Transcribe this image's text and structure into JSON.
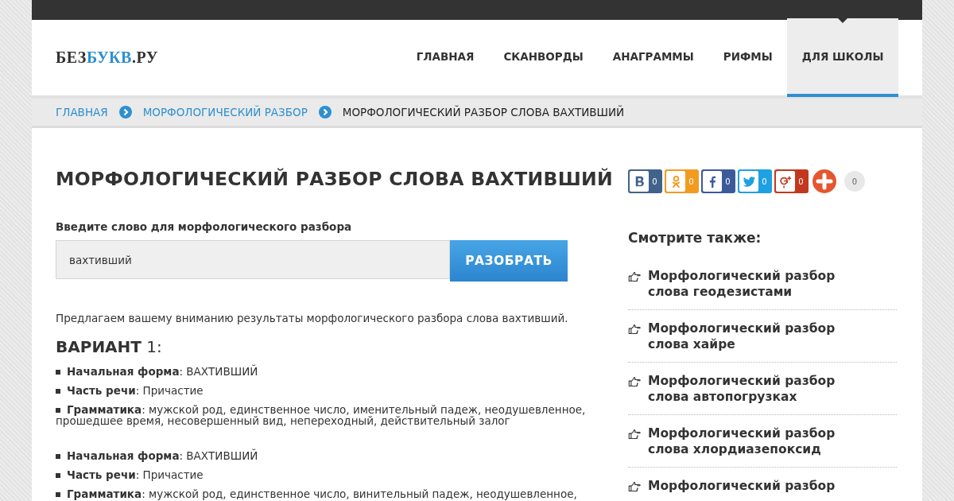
{
  "logo": {
    "parts": [
      {
        "text": "БЕЗ",
        "accent": false
      },
      {
        "text": "БУКВ",
        "accent": true
      },
      {
        "text": ".РУ",
        "accent": false
      }
    ]
  },
  "nav": [
    {
      "label": "ГЛАВНАЯ",
      "selected": false
    },
    {
      "label": "СКАНВОРДЫ",
      "selected": false
    },
    {
      "label": "АНАГРАММЫ",
      "selected": false
    },
    {
      "label": "РИФМЫ",
      "selected": false
    },
    {
      "label": "ДЛЯ ШКОЛЫ",
      "selected": true
    }
  ],
  "breadcrumbs": [
    {
      "label": "ГЛАВНАЯ",
      "link": true
    },
    {
      "label": "МОРФОЛОГИЧЕСКИЙ РАЗБОР",
      "link": true
    },
    {
      "label": "МОРФОЛОГИЧЕСКИЙ РАЗБОР СЛОВА ВАХТИВШИЙ",
      "link": false
    }
  ],
  "title": "МОРФОЛОГИЧЕСКИЙ РАЗБОР СЛОВА ВАХТИВШИЙ",
  "form": {
    "label": "Введите слово для морфологического разбора",
    "value": "вахтивший",
    "button": "РАЗОБРАТЬ"
  },
  "intro": "Предлагаем вашему вниманию результаты морфологического разбора слова вахтивший.",
  "variant_heading": {
    "word": "ВАРИАНТ",
    "number": "1:"
  },
  "results": [
    {
      "items": [
        "**Начальная форма**: ВАХТИВШИЙ",
        "**Часть речи**: Причастие",
        "**Грамматика**: мужской род, единственное число, именительный падеж, неодушевленное, прошедшее время, несовершенный вид, непереходный, действительный залог"
      ]
    },
    {
      "items": [
        "**Начальная форма**: ВАХТИВШИЙ",
        "**Часть речи**: Причастие",
        "**Грамматика**: мужской род, единственное число, винительный падеж, неодушевленное,"
      ]
    }
  ],
  "share": {
    "buttons": [
      {
        "kind": "vk",
        "count": "0"
      },
      {
        "kind": "ok",
        "count": "0"
      },
      {
        "kind": "fb",
        "count": "0"
      },
      {
        "kind": "tw",
        "count": "0"
      },
      {
        "kind": "gp",
        "count": "0"
      }
    ],
    "total": "0"
  },
  "see_also": {
    "heading": "Смотрите также:",
    "links": [
      {
        "lines": [
          "Морфологический разбор",
          "слова геодезистами"
        ]
      },
      {
        "lines": [
          "Морфологический разбор",
          "слова хайре"
        ]
      },
      {
        "lines": [
          "Морфологический разбор",
          "слова автопогрузках"
        ]
      },
      {
        "lines": [
          "Морфологический разбор",
          "слова хлордиазепоксид"
        ]
      },
      {
        "lines": [
          "Морфологический разбор"
        ]
      }
    ]
  }
}
